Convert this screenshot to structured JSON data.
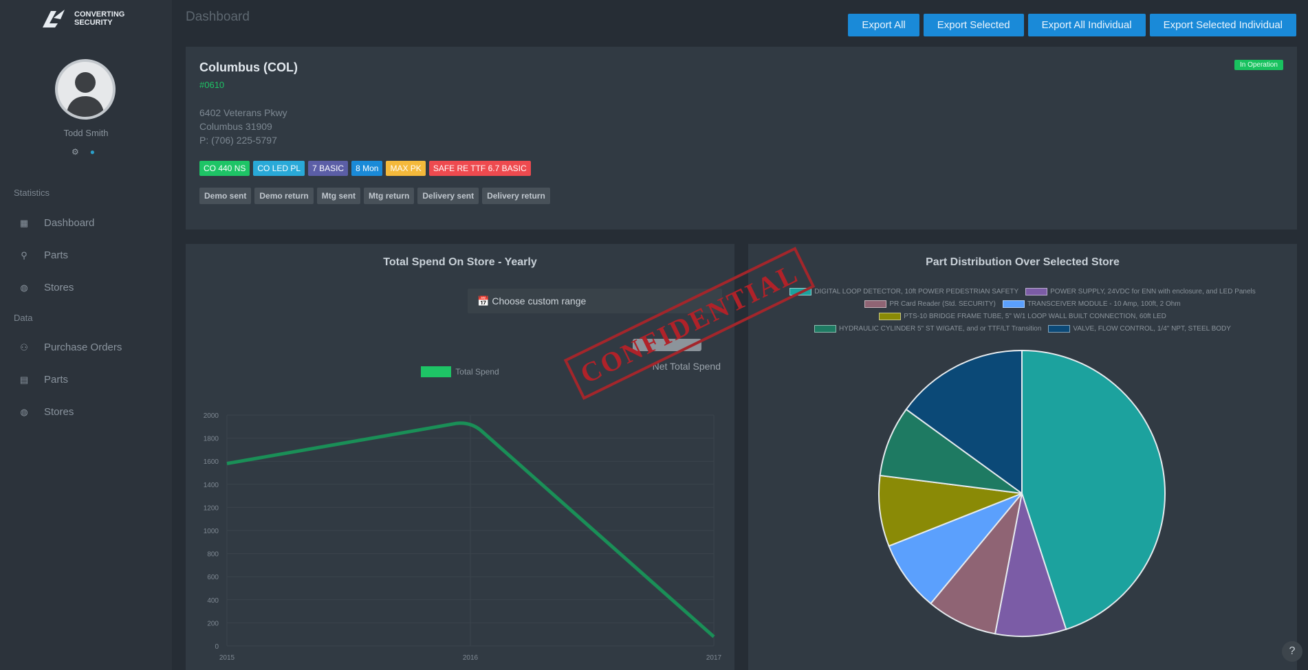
{
  "brand": {
    "line1": "CONVERTING",
    "line2": "SECURITY"
  },
  "user": {
    "name": "Todd Smith"
  },
  "sidebar": {
    "sections": [
      {
        "label": "Statistics",
        "items": [
          {
            "label": "Dashboard",
            "icon": "dashboard-icon"
          },
          {
            "label": "Parts",
            "icon": "parts-icon"
          },
          {
            "label": "Stores",
            "icon": "store-icon"
          }
        ]
      },
      {
        "label": "Data",
        "items": [
          {
            "label": "Purchase Orders",
            "icon": "purchase-orders-icon"
          },
          {
            "label": "Parts",
            "icon": "parts-icon"
          },
          {
            "label": "Stores",
            "icon": "store-icon"
          }
        ]
      }
    ]
  },
  "header": {
    "title": "Dashboard",
    "buttons": [
      "Export All",
      "Export Selected",
      "Export All Individual",
      "Export Selected Individual"
    ]
  },
  "store": {
    "name": "Columbus (COL)",
    "code": "#0610",
    "status": "In Operation",
    "address_line1": "6402 Veterans Pkwy",
    "address_line2": "Columbus 31909",
    "phone": "P: (706) 225-5797",
    "tags": [
      {
        "label": "CO 440 NS",
        "color": "#1ec466"
      },
      {
        "label": "CO LED PL",
        "color": "#29a9d8"
      },
      {
        "label": "7 BASIC",
        "color": "#5b5ea6"
      },
      {
        "label": "8 Mon",
        "color": "#1a8ad8"
      },
      {
        "label": "MAX PK",
        "color": "#f4b93b"
      },
      {
        "label": "SAFE RE TTF 6.7 BASIC",
        "color": "#ee4a4f"
      }
    ],
    "group_tags": [
      "Demo sent",
      "Demo return",
      "Mtg sent",
      "Mtg return",
      "Delivery sent",
      "Delivery return"
    ]
  },
  "line_chart": {
    "title": "Total Spend On Store - Yearly",
    "range_label": "Choose custom range",
    "total_label": "Net Total Spend",
    "stamp": "CONFIDENTIAL"
  },
  "pie_chart": {
    "title": "Part Distribution Over Selected Store"
  },
  "chart_data": [
    {
      "type": "line",
      "title": "Total Spend On Store - Yearly",
      "series": [
        {
          "name": "Total Spend",
          "color": "#1a8f57",
          "values": [
            1580,
            1940,
            80
          ]
        }
      ],
      "x": [
        "2015",
        "2016",
        "2017"
      ],
      "yticks": [
        "0",
        "200",
        "400",
        "600",
        "800",
        "1000",
        "1200",
        "1400",
        "1600",
        "1800",
        "2000"
      ],
      "ylim": [
        0,
        2000
      ],
      "grid": true,
      "legend": "top"
    },
    {
      "type": "pie",
      "title": "Part Distribution Over Selected Store",
      "labels": [
        "DIGITAL LOOP DETECTOR, 10ft POWER PEDESTRIAN SAFETY",
        "POWER SUPPLY, 24VDC for ENN with enclosure, and LED Panels",
        "PR Card Reader (Std. SECURITY)",
        "TRANSCEIVER MODULE - 10 Amp, 100ft, 2 Ohm",
        "PTS-10 BRIDGE FRAME TUBE, 5\" W/1 LOOP WALL BUILT CONNECTION, 60ft LED",
        "HYDRAULIC CYLINDER 5\" ST W/GATE, and or TTF/LT Transition",
        "VALVE, FLOW CONTROL, 1/4\" NPT, STEEL BODY"
      ],
      "values": [
        45,
        8,
        8,
        8,
        8,
        8,
        15
      ],
      "colors": [
        "#1ca29e",
        "#7b5ca6",
        "#8f6474",
        "#5ba0fd",
        "#8a8a06",
        "#1e7a62",
        "#0b4977"
      ],
      "legend": "top"
    }
  ]
}
